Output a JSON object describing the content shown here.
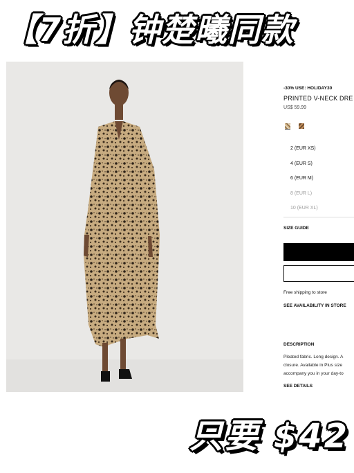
{
  "banner_top": {
    "text": "【7折】钟楚曦同款"
  },
  "product": {
    "promo": "-30% USE: HOLIDAY30",
    "name": "PRINTED V-NECK DRE",
    "price": "US$ 59.99",
    "swatches": [
      "leopard-print",
      "brown-print"
    ],
    "sizes": [
      {
        "label": "2 (EUR XS)",
        "available": true
      },
      {
        "label": "4 (EUR S)",
        "available": true
      },
      {
        "label": "6 (EUR M)",
        "available": true
      },
      {
        "label": "8 (EUR L)",
        "available": false
      },
      {
        "label": "10 (EUR XL)",
        "available": false
      }
    ],
    "size_guide": "SIZE GUIDE",
    "shipping": "Free shipping to store",
    "availability": "SEE AVAILABILITY IN STORE",
    "description_title": "DESCRIPTION",
    "description_lines": [
      "Pleated fabric. Long design. A",
      "closure. Available in Plus size",
      "accompany you in your day-to"
    ],
    "see_details": "SEE DETAILS"
  },
  "banner_bottom": {
    "text": "只要 $42"
  },
  "colors": {
    "background": "#ffffff",
    "photo_backdrop": "#e9e8e6",
    "add_button": "#000000",
    "unavailable_text": "#9a9a9a"
  }
}
